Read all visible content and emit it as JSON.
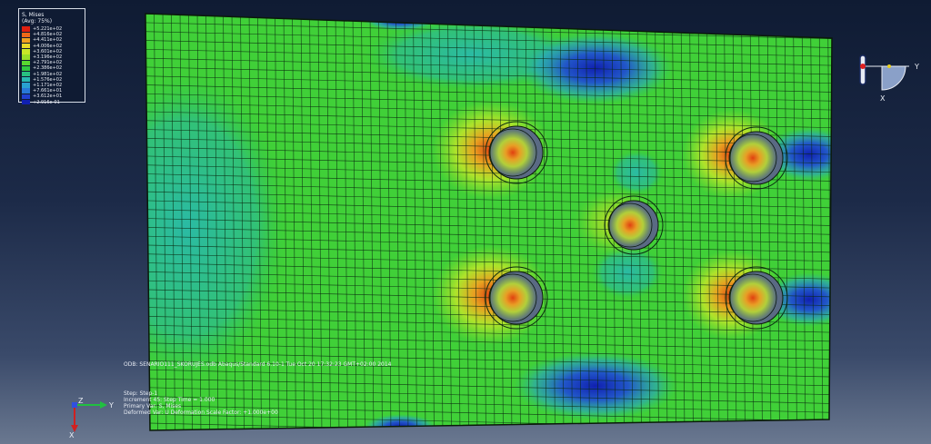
{
  "legend": {
    "title": "S, Mises",
    "subtitle": "(Avg: 75%)",
    "values": [
      "+5.221e+02",
      "+4.816e+02",
      "+4.411e+02",
      "+4.006e+02",
      "+3.601e+02",
      "+3.196e+02",
      "+2.791e+02",
      "+2.386e+02",
      "+1.981e+02",
      "+1.576e+02",
      "+1.171e+02",
      "+7.661e+01",
      "+3.612e+01",
      "+2.916e-01"
    ],
    "colors": [
      "#e02010",
      "#f06818",
      "#f0a020",
      "#e8d828",
      "#c8e828",
      "#98e028",
      "#58d830",
      "#30c840",
      "#28c080",
      "#28b8b0",
      "#28a0d0",
      "#2878d8",
      "#2040d0",
      "#1020b0"
    ]
  },
  "status": {
    "odb_line": "ODB: SENARIO111_SKORUJES.odb   Abaqus/Standard 6.10-1   Tue Oct 20 17:32:23 GMT+02:00 2014",
    "step_line": "Step: Step-1",
    "increment_line": "Increment      45: Step Time =    1.000",
    "primary_line": "Primary Var: S, Mises",
    "deformed_line": "Deformed Var: U   Deformation Scale Factor: +1.000e+00"
  },
  "triad": {
    "y": "Y",
    "z": "Z",
    "x": "X"
  },
  "viewcube": {
    "y": "Y",
    "x": "X"
  }
}
